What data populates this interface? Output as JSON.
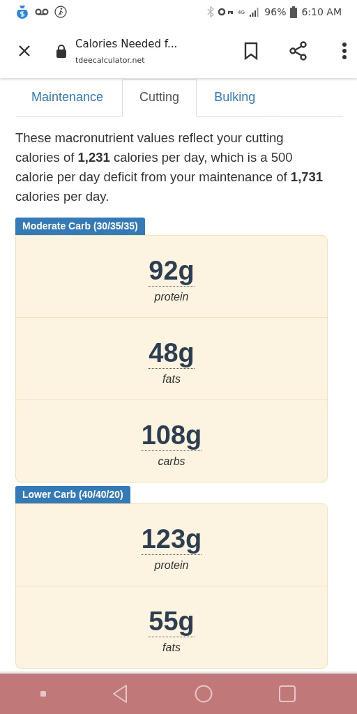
{
  "status_bar": {
    "network": "4G",
    "battery": "96%",
    "time": "6:10 AM"
  },
  "browser_toolbar": {
    "title": "Calories Needed f...",
    "url": "tdeecalculator.net"
  },
  "tabs": [
    {
      "label": "Maintenance",
      "selected": false
    },
    {
      "label": "Cutting",
      "selected": true
    },
    {
      "label": "Bulking",
      "selected": false
    }
  ],
  "description": "These macronutrient values reflect your cutting calories of **1,231** calories per day, which is a 500 calorie per day deficit from your maintenance of **1,731** calories per day.",
  "plans": [
    {
      "label": "Moderate Carb (30/35/35)",
      "macros": [
        {
          "amount": "92g",
          "name": "protein"
        },
        {
          "amount": "48g",
          "name": "fats"
        },
        {
          "amount": "108g",
          "name": "carbs"
        }
      ]
    },
    {
      "label": "Lower Carb (40/40/20)",
      "macros": [
        {
          "amount": "123g",
          "name": "protein"
        },
        {
          "amount": "55g",
          "name": "fats"
        }
      ]
    }
  ]
}
